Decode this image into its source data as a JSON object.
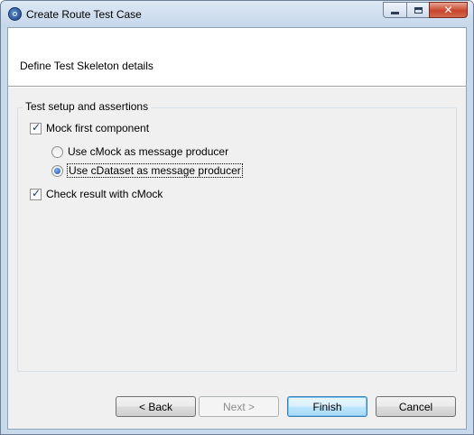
{
  "window": {
    "title": "Create Route Test Case",
    "controls": {
      "minimize": "minimize",
      "maximize": "maximize",
      "close": "✕"
    }
  },
  "header": {
    "description": "Define Test Skeleton details"
  },
  "group": {
    "title": "Test setup and assertions",
    "mock_first": {
      "label": "Mock first component",
      "checked": true
    },
    "producer_options": [
      {
        "label": "Use cMock as message producer",
        "selected": false
      },
      {
        "label": "Use cDataset as message producer",
        "selected": true
      }
    ],
    "check_result": {
      "label": "Check result with cMock",
      "checked": true
    }
  },
  "buttons": {
    "back": "< Back",
    "next": "Next >",
    "finish": "Finish",
    "cancel": "Cancel"
  }
}
